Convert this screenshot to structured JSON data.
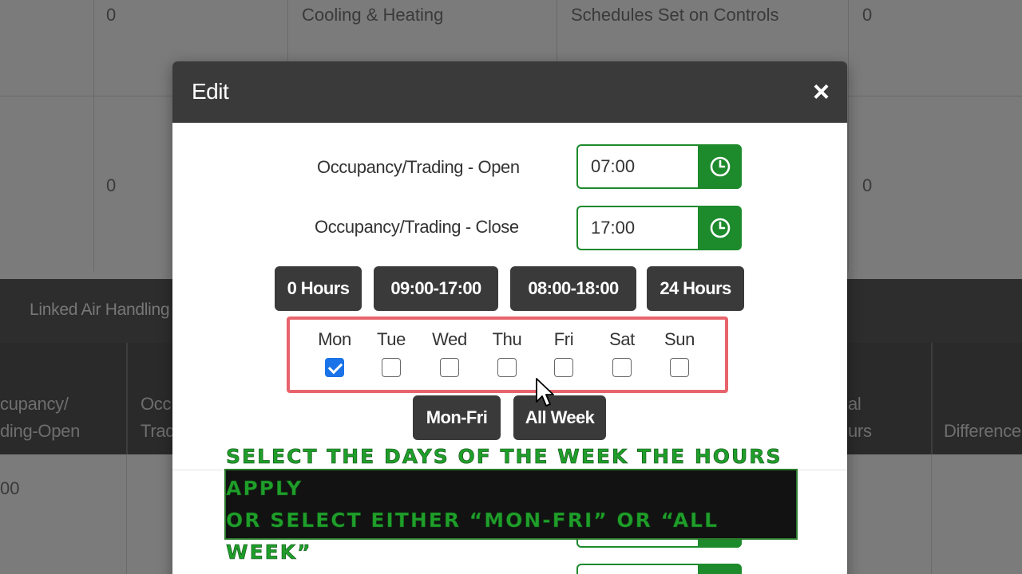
{
  "background": {
    "top_row": {
      "col1": "0",
      "col2": "Cooling & Heating",
      "col3": "Schedules Set on Controls",
      "col4": "0"
    },
    "second_row": {
      "col1": "0",
      "col4": "0"
    },
    "section_label": "Linked Air Handling",
    "table_headers": [
      {
        "line1": "cupancy/",
        "line2": "ding-Open"
      },
      {
        "line1": "Occ",
        "line2": "Trad"
      },
      {
        "line1": "al",
        "line2": "urs"
      },
      {
        "line1": "Difference",
        "line2": ""
      }
    ],
    "first_cell": "00"
  },
  "modal": {
    "title": "Edit",
    "close_label": "×",
    "open": {
      "label": "Occupancy/Trading - Open",
      "value": "07:00"
    },
    "close": {
      "label": "Occupancy/Trading - Close",
      "value": "17:00"
    },
    "presets": [
      "0 Hours",
      "09:00-17:00",
      "08:00-18:00",
      "24 Hours"
    ],
    "days": [
      {
        "label": "Mon",
        "checked": true
      },
      {
        "label": "Tue",
        "checked": false
      },
      {
        "label": "Wed",
        "checked": false
      },
      {
        "label": "Thu",
        "checked": false
      },
      {
        "label": "Fri",
        "checked": false
      },
      {
        "label": "Sat",
        "checked": false
      },
      {
        "label": "Sun",
        "checked": false
      }
    ],
    "day_groups": [
      "Mon-Fri",
      "All Week"
    ]
  },
  "caption": {
    "line1": "Select the days of the week the hours apply",
    "line2": "or select either “Mon-Fri” or “All Week”"
  },
  "colors": {
    "accent_green": "#1d8a2c",
    "header_dark": "#3a3a3a",
    "highlight_red": "#e8646c",
    "checkbox_blue": "#1a73e8",
    "caption_green": "#1f9e2a"
  }
}
